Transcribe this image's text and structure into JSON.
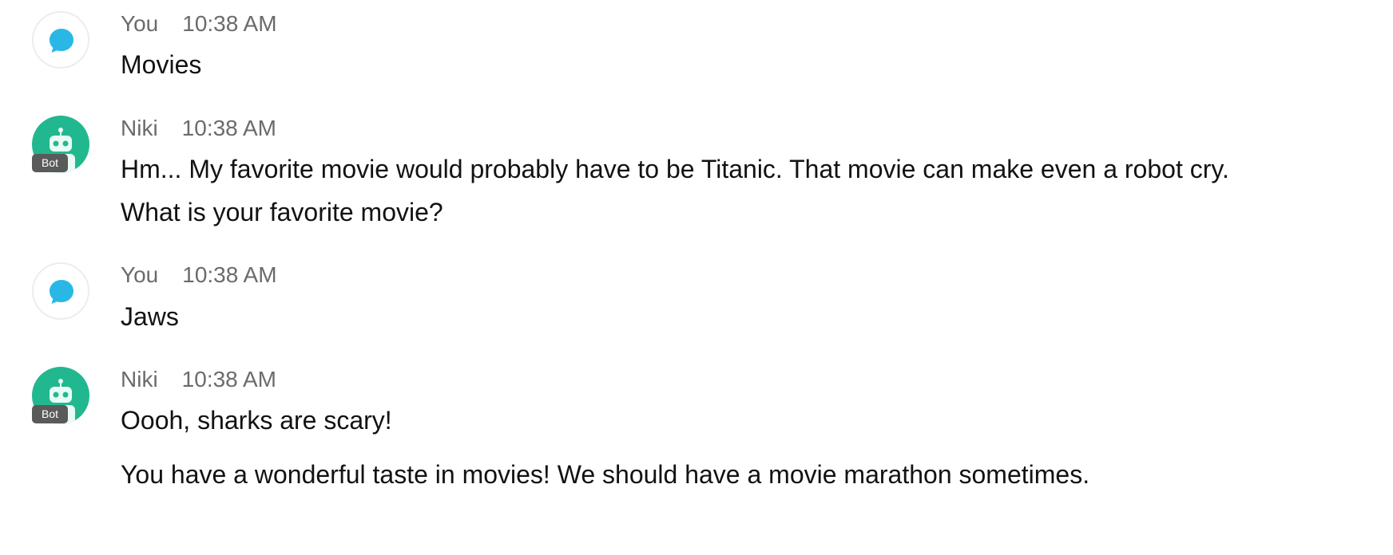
{
  "messages": [
    {
      "sender": "You",
      "time": "10:38 AM",
      "text": "Movies",
      "avatar": "chat-bubble-icon"
    },
    {
      "sender": "Niki",
      "time": "10:38 AM",
      "text": "Hm... My favorite movie would probably have to be Titanic. That movie can make even a robot cry. What is your favorite movie?",
      "avatar": "robot-icon",
      "badge": "Bot"
    },
    {
      "sender": "You",
      "time": "10:38 AM",
      "text": "Jaws",
      "avatar": "chat-bubble-icon"
    },
    {
      "sender": "Niki",
      "time": "10:38 AM",
      "text": "Oooh, sharks are scary!",
      "text2": "You have a wonderful taste in movies! We should have a movie marathon sometimes.",
      "avatar": "robot-icon",
      "badge": "Bot"
    }
  ],
  "colors": {
    "user_bubble": "#29b8e6",
    "bot_avatar": "#22b88f",
    "badge_bg": "#5a5a5a",
    "meta_text": "#6b6b6b",
    "body_text": "#121212"
  }
}
